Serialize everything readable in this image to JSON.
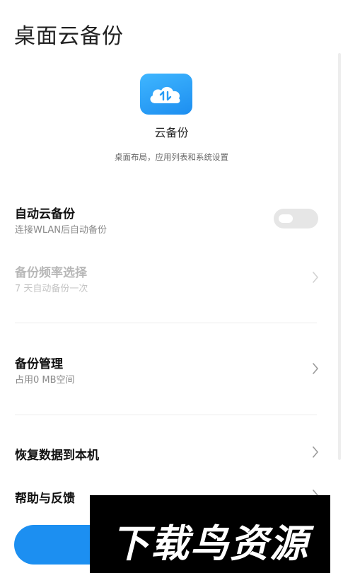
{
  "header": {
    "title": "桌面云备份"
  },
  "app": {
    "icon": "cloud-sync-icon",
    "name": "云备份",
    "description": "桌面布局，应用列表和系统设置",
    "accent": "#1c8ff1"
  },
  "settings": {
    "auto_backup": {
      "title": "自动云备份",
      "subtitle": "连接WLAN后自动备份",
      "enabled": false
    },
    "frequency": {
      "title": "备份频率选择",
      "subtitle": "7 天自动备份一次",
      "disabled": true
    },
    "manage": {
      "title": "备份管理",
      "subtitle": "占用0 MB空间"
    },
    "restore": {
      "title": "恢复数据到本机"
    },
    "help": {
      "title": "帮助与反馈"
    }
  },
  "watermark": {
    "text": "下载鸟资源"
  }
}
